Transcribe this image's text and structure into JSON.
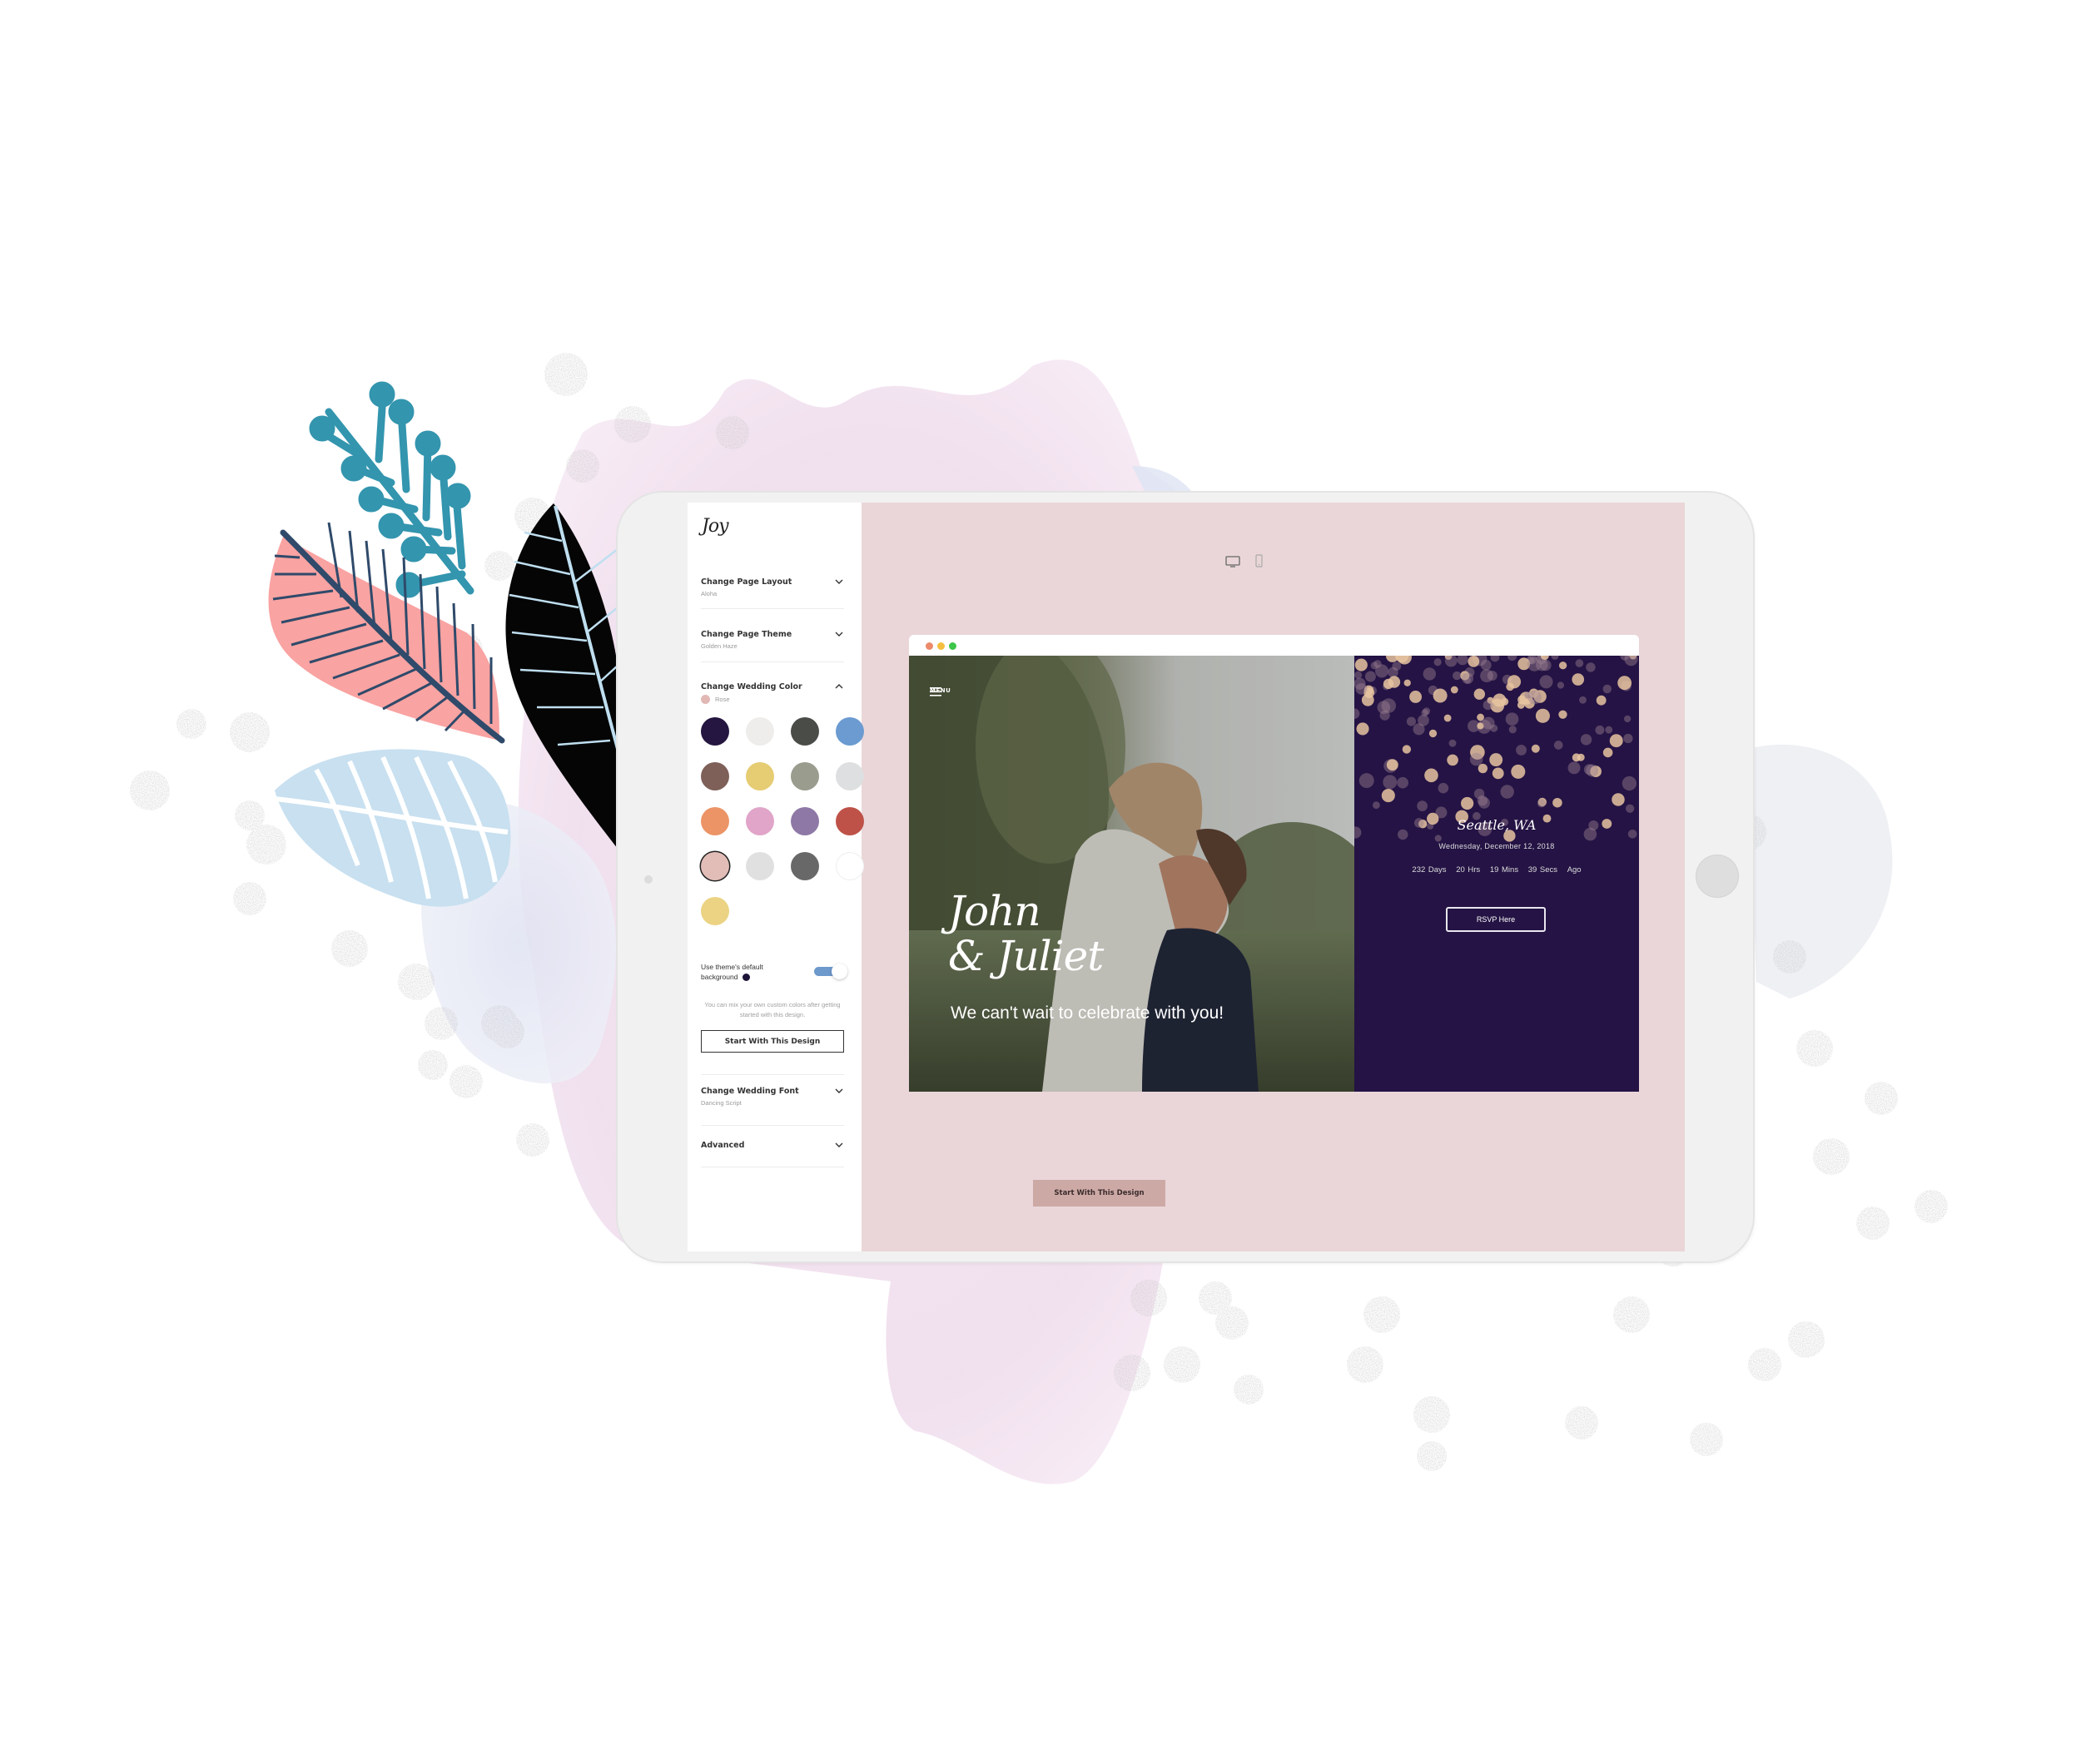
{
  "app": {
    "logo": "Joy"
  },
  "sidebar": {
    "sections": [
      {
        "title": "Change Page Layout",
        "value": "Aloha",
        "expanded": false
      },
      {
        "title": "Change Page Theme",
        "value": "Golden Haze",
        "expanded": false
      },
      {
        "title": "Change Wedding Color",
        "value": "Rose",
        "expanded": true
      },
      {
        "title": "Change Wedding Font",
        "value": "Dancing Script",
        "expanded": false
      },
      {
        "title": "Advanced",
        "value": "",
        "expanded": false
      }
    ],
    "color_swatches": [
      {
        "name": "midnight",
        "color": "#241640"
      },
      {
        "name": "ivory",
        "color": "#efedeb"
      },
      {
        "name": "charcoal",
        "color": "#4a4c48"
      },
      {
        "name": "sky-blue",
        "color": "#6b9bd0"
      },
      {
        "name": "mocha",
        "color": "#7e6058"
      },
      {
        "name": "gold-dots",
        "color": "#e6cc72"
      },
      {
        "name": "sage",
        "color": "#9a9c8e"
      },
      {
        "name": "light-gray",
        "color": "#dedfe0"
      },
      {
        "name": "coral",
        "color": "#ec9466"
      },
      {
        "name": "pink",
        "color": "#e0a5c8"
      },
      {
        "name": "lavender",
        "color": "#8e78a6"
      },
      {
        "name": "brick-red",
        "color": "#be5248"
      },
      {
        "name": "rose",
        "color": "#e2bdb8",
        "selected": true
      },
      {
        "name": "silver",
        "color": "#e0e0e0"
      },
      {
        "name": "graphite",
        "color": "#686868"
      },
      {
        "name": "white",
        "color": "#ffffff"
      },
      {
        "name": "butter",
        "color": "#ebd383"
      }
    ],
    "default_background": {
      "label": "Use theme's default background",
      "enabled": true,
      "swatch_color": "#1e1438"
    },
    "hint": "You can mix your own custom colors after getting started with this design.",
    "start_button": "Start With This Design"
  },
  "preview": {
    "device_toggle": [
      "desktop",
      "mobile"
    ],
    "browser_dots": [
      "#ec8a6a",
      "#f5be3e",
      "#3cc548"
    ],
    "menu_label": "MENU",
    "couple_line1": "John",
    "couple_line2": "& Juliet",
    "tagline": "We can't wait to celebrate with you!",
    "location": "Seattle, WA",
    "date": "Wednesday, December 12, 2018",
    "countdown": {
      "days": "232 Days",
      "hours": "20 Hrs",
      "mins": "19 Mins",
      "secs": "39 Secs",
      "suffix": "Ago"
    },
    "rsvp_button": "RSVP Here",
    "start_button": "Start With This Design"
  },
  "colors": {
    "accent_rose": "#cda9a5",
    "preview_bg": "#ead6d8",
    "panel_purple": "#241344",
    "toggle_blue": "#6d99cc"
  }
}
